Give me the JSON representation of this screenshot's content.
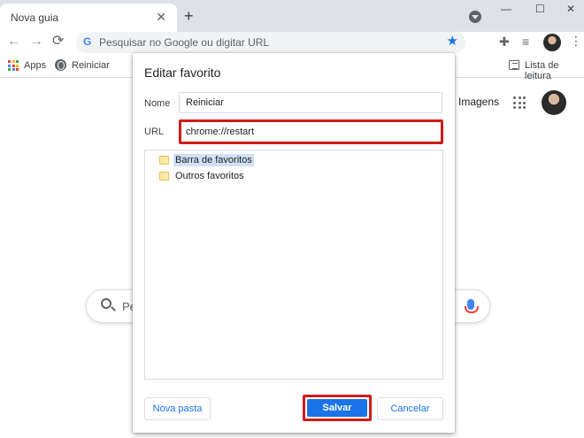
{
  "tab": {
    "title": "Nova guia",
    "close_glyph": "✕",
    "new_tab_glyph": "+"
  },
  "window_controls": {
    "minimize": "—",
    "maximize": "☐",
    "close": "✕"
  },
  "toolbar": {
    "back_glyph": "←",
    "forward_glyph": "→",
    "reload_glyph": "⟳",
    "omnibox_placeholder": "Pesquisar no Google ou digitar URL",
    "google_glyph": "G",
    "star_glyph": "★",
    "extensions_glyph": "✚",
    "media_glyph": "≡",
    "more_glyph": "⋮"
  },
  "bookmarks_bar": {
    "apps_label": "Apps",
    "item_label": "Reiniciar",
    "reading_list_label": "Lista de leitura",
    "apps_colors": [
      "#ea4335",
      "#fbbc05",
      "#34a853",
      "#4285f4",
      "#ea4335",
      "#fbbc05",
      "#34a853",
      "#4285f4",
      "#ea4335"
    ]
  },
  "page": {
    "images_link": "Imagens",
    "search_placeholder": "Pe"
  },
  "dialog": {
    "title": "Editar favorito",
    "name_label": "Nome",
    "name_value": "Reiniciar",
    "url_label": "URL",
    "url_value": "chrome://restart",
    "folders": [
      {
        "label": "Barra de favoritos",
        "selected": true
      },
      {
        "label": "Outros favoritos",
        "selected": false
      }
    ],
    "new_folder_label": "Nova pasta",
    "save_label": "Salvar",
    "cancel_label": "Cancelar"
  },
  "colors": {
    "accent": "#1a73e8",
    "highlight_border": "#d11a1a",
    "selected_folder_bg": "#cfe0f7"
  },
  "icons": [
    "search-icon",
    "mic-icon",
    "folder-icon",
    "star-icon",
    "globe-icon",
    "apps-grid-icon",
    "extensions-icon",
    "reading-list-icon"
  ]
}
